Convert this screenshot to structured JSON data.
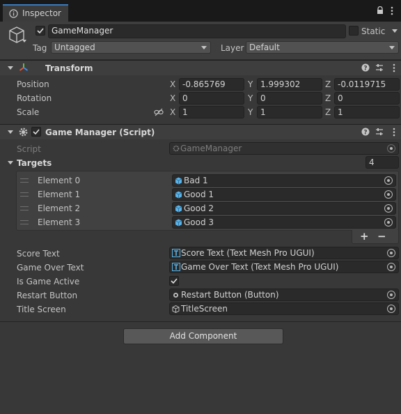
{
  "tab": {
    "title": "Inspector",
    "icon": "info-icon"
  },
  "header": {
    "object_name": "GameManager",
    "active": true,
    "static_label": "Static",
    "static": false,
    "tag_label": "Tag",
    "tag_value": "Untagged",
    "layer_label": "Layer",
    "layer_value": "Default"
  },
  "transform": {
    "title": "Transform",
    "position": {
      "label": "Position",
      "x": "-0.865769",
      "y": "1.999302",
      "z": "-0.0119715"
    },
    "rotation": {
      "label": "Rotation",
      "x": "0",
      "y": "0",
      "z": "0"
    },
    "scale": {
      "label": "Scale",
      "x": "1",
      "y": "1",
      "z": "1"
    },
    "axis": {
      "x": "X",
      "y": "Y",
      "z": "Z"
    }
  },
  "script_component": {
    "title": "Game Manager (Script)",
    "enabled": true,
    "script_label": "Script",
    "script_value": "GameManager",
    "targets_label": "Targets",
    "targets_count": "4",
    "elements": [
      {
        "label": "Element 0",
        "value": "Bad 1"
      },
      {
        "label": "Element 1",
        "value": "Good 1"
      },
      {
        "label": "Element 2",
        "value": "Good 2"
      },
      {
        "label": "Element 3",
        "value": "Good 3"
      }
    ],
    "add_label": "+",
    "remove_label": "−",
    "score_text_label": "Score Text",
    "score_text_value": "Score Text (Text Mesh Pro UGUI)",
    "game_over_label": "Game Over Text",
    "game_over_value": "Game Over Text (Text Mesh Pro UGUI)",
    "is_active_label": "Is Game Active",
    "is_active": true,
    "restart_label": "Restart Button",
    "restart_value": "Restart Button (Button)",
    "title_screen_label": "Title Screen",
    "title_screen_value": "TitleScreen"
  },
  "add_component_label": "Add Component",
  "colors": {
    "accent": "#3a79bb",
    "background": "#383838",
    "field": "#2a2a2a"
  }
}
